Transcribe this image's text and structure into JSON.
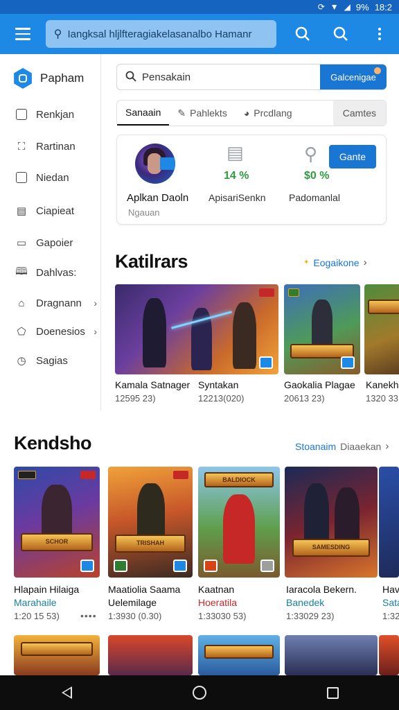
{
  "status_bar": {
    "battery": "9%",
    "time": "18:2"
  },
  "app_bar": {
    "search_text": "Iangksal hljlfteragiakelasanalbo Hamanr",
    "accent": "#1e88e5"
  },
  "sidebar": {
    "brand": "Papham",
    "items": [
      {
        "label": "Renkjan",
        "icon": "square-icon"
      },
      {
        "label": "Rartinan",
        "icon": "image-icon"
      },
      {
        "label": "Niedan",
        "icon": "square-icon"
      },
      {
        "label": "Ciapieat",
        "icon": "calendar-icon"
      },
      {
        "label": "Gapoier",
        "icon": "card-icon"
      },
      {
        "label": "Dahlvas:",
        "icon": "book-icon"
      },
      {
        "label": "Dragnann",
        "icon": "folder-icon"
      },
      {
        "label": "Doenesios",
        "icon": "badge-icon"
      },
      {
        "label": "Sagias",
        "icon": "clock-icon"
      }
    ]
  },
  "panel": {
    "search_value": "Pensakain",
    "search_button": "Galcenigae",
    "tabs": [
      "Sanaain",
      "Pahlekts",
      "Prcdlang",
      "Camtes"
    ],
    "card": {
      "user_name": "Aplkan Daoln",
      "user_sub": "Ngauan",
      "stat1_value": "14 %",
      "stat1_label": "ApisariSenkn",
      "stat2_value": "$0 %",
      "stat2_label": "Padomanlal",
      "button": "Gante"
    }
  },
  "section1": {
    "title": "Katilrars",
    "link": "Eogaikone",
    "cards": [
      {
        "title": "Kamala Satnager",
        "sub": "12595 23)"
      },
      {
        "title": "Syntakan",
        "sub": "12213(020)"
      },
      {
        "title": "Gaokalia Plagae",
        "sub": "20613 23)"
      },
      {
        "title": "Kanekh",
        "sub": "1320 33"
      }
    ]
  },
  "section2": {
    "title": "Kendsho",
    "link": "Stoanaim",
    "link_secondary": "Diaaekan",
    "more": "••••",
    "cards": [
      {
        "title": "Hlapain Hilaiga",
        "dev": "Marahaile",
        "sub": "1:20 15 53)"
      },
      {
        "title": "Maatiolia Saama",
        "title2": "Uelemilage",
        "sub": "1:3930 (0.30)"
      },
      {
        "title": "Kaatnan",
        "dev": "Hoeratila",
        "sub": "1:33030 53)"
      },
      {
        "title": "Iaracola Bekern.",
        "dev": "Banedek",
        "sub": "1:33029 23)"
      },
      {
        "title": "Hav",
        "dev": "Sata",
        "sub": "1:32"
      }
    ],
    "banner_labels": [
      "SCHOR",
      "TRISHAH",
      "BALDIOCK",
      "SAMESDING"
    ]
  }
}
